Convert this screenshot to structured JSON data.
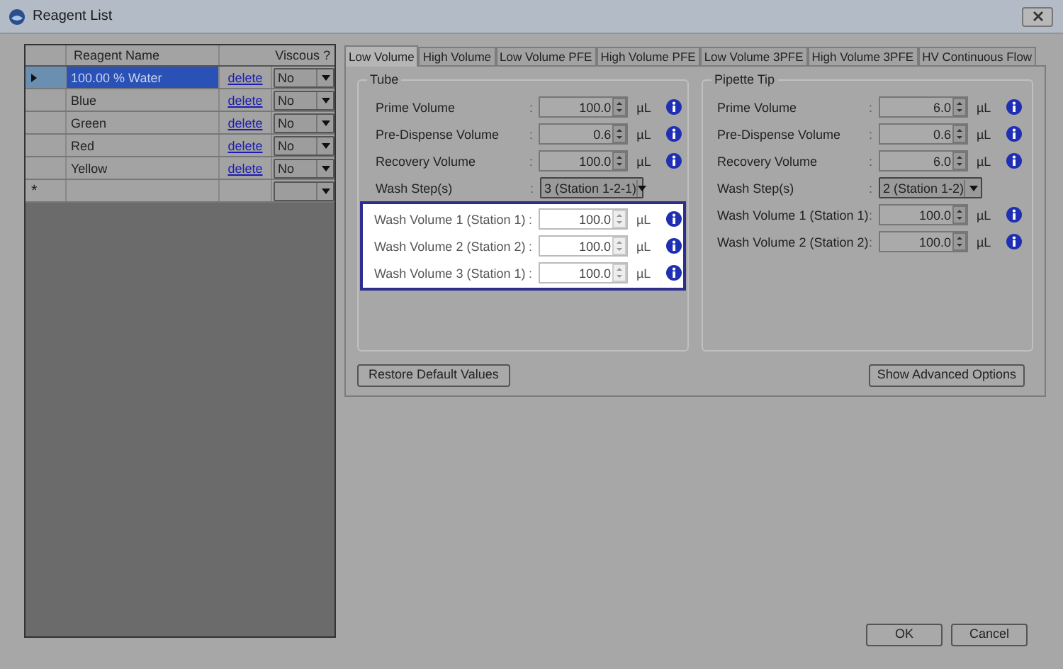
{
  "window": {
    "title": "Reagent List"
  },
  "grid": {
    "columns": [
      "Reagent Name",
      "Viscous ?"
    ],
    "rows": [
      {
        "name": "100.00 % Water",
        "action": "delete",
        "viscous": "No",
        "selected": true
      },
      {
        "name": "Blue",
        "action": "delete",
        "viscous": "No",
        "selected": false
      },
      {
        "name": "Green",
        "action": "delete",
        "viscous": "No",
        "selected": false
      },
      {
        "name": "Red",
        "action": "delete",
        "viscous": "No",
        "selected": false
      },
      {
        "name": "Yellow",
        "action": "delete",
        "viscous": "No",
        "selected": false
      }
    ],
    "new_row_marker": "*"
  },
  "tabs": [
    {
      "label": "Low Volume",
      "selected": true
    },
    {
      "label": "High Volume",
      "selected": false
    },
    {
      "label": "Low Volume PFE",
      "selected": false
    },
    {
      "label": "High Volume PFE",
      "selected": false
    },
    {
      "label": "Low Volume 3PFE",
      "selected": false
    },
    {
      "label": "High Volume 3PFE",
      "selected": false
    },
    {
      "label": "HV Continuous Flow",
      "selected": false
    }
  ],
  "groups": [
    {
      "title": "Tube",
      "fields": [
        {
          "kind": "spin",
          "label": "Prime Volume",
          "value": "100.0",
          "unit": "µL",
          "highlighted": false
        },
        {
          "kind": "spin",
          "label": "Pre-Dispense Volume",
          "value": "0.6",
          "unit": "µL",
          "highlighted": false
        },
        {
          "kind": "spin",
          "label": "Recovery Volume",
          "value": "100.0",
          "unit": "µL",
          "highlighted": false
        },
        {
          "kind": "dropdown",
          "label": "Wash Step(s)",
          "value": "3 (Station 1-2-1)",
          "highlighted": false
        },
        {
          "kind": "spin",
          "label": "Wash Volume 1 (Station 1)",
          "value": "100.0",
          "unit": "µL",
          "highlighted": true
        },
        {
          "kind": "spin",
          "label": "Wash Volume 2 (Station 2)",
          "value": "100.0",
          "unit": "µL",
          "highlighted": true
        },
        {
          "kind": "spin",
          "label": "Wash Volume 3 (Station 1)",
          "value": "100.0",
          "unit": "µL",
          "highlighted": true
        }
      ]
    },
    {
      "title": "Pipette Tip",
      "fields": [
        {
          "kind": "spin",
          "label": "Prime Volume",
          "value": "6.0",
          "unit": "µL",
          "highlighted": false
        },
        {
          "kind": "spin",
          "label": "Pre-Dispense Volume",
          "value": "0.6",
          "unit": "µL",
          "highlighted": false
        },
        {
          "kind": "spin",
          "label": "Recovery Volume",
          "value": "6.0",
          "unit": "µL",
          "highlighted": false
        },
        {
          "kind": "dropdown",
          "label": "Wash Step(s)",
          "value": "2 (Station 1-2)",
          "highlighted": false
        },
        {
          "kind": "spin",
          "label": "Wash Volume 1 (Station 1)",
          "value": "100.0",
          "unit": "µL",
          "highlighted": false
        },
        {
          "kind": "spin",
          "label": "Wash Volume 2 (Station 2)",
          "value": "100.0",
          "unit": "µL",
          "highlighted": false
        }
      ]
    }
  ],
  "separator": ":",
  "buttons": {
    "restore": "Restore Default Values",
    "advanced": "Show Advanced Options",
    "ok": "OK",
    "cancel": "Cancel"
  }
}
